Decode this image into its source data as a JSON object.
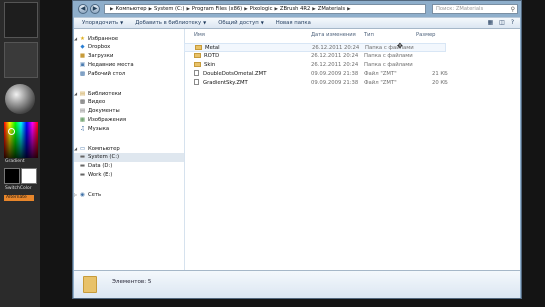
{
  "zbrush": {
    "gradient_label": "Gradient",
    "switch_color_label": "SwitchColor",
    "alternate_label": "Alternate"
  },
  "address": {
    "breadcrumbs": [
      "Компьютер",
      "System (C:)",
      "Program Files (x86)",
      "Pixologic",
      "ZBrush 4R2",
      "ZMaterials"
    ],
    "search_placeholder": "Поиск: ZMaterials"
  },
  "toolbar": {
    "organize": "Упорядочить",
    "add_to_library": "Добавить в библиотеку",
    "share": "Общий доступ",
    "new_folder": "Новая папка"
  },
  "nav": {
    "favorites": "Избранное",
    "dropbox": "Dropbox",
    "downloads": "Загрузки",
    "recent": "Недавние места",
    "desktop": "Рабочий стол",
    "libraries": "Библиотеки",
    "videos": "Видео",
    "documents": "Документы",
    "images": "Изображения",
    "music": "Музыка",
    "computer": "Компьютер",
    "drive_c": "System (C:)",
    "drive_d": "Data (D:)",
    "drive_e": "Work (E:)",
    "network": "Сеть"
  },
  "columns": {
    "name": "Имя",
    "modified": "Дата изменения",
    "type": "Тип",
    "size": "Размер"
  },
  "files": [
    {
      "name": "Metal",
      "modified": "26.12.2011 20:24",
      "type": "Папка с файлами",
      "size": ""
    },
    {
      "name": "ROTD",
      "modified": "26.12.2011 20:24",
      "type": "Папка с файлами",
      "size": ""
    },
    {
      "name": "Skin",
      "modified": "26.12.2011 20:24",
      "type": "Папка с файлами",
      "size": ""
    },
    {
      "name": "DoubleDotsOmetal.ZMT",
      "modified": "09.09.2009 21:38",
      "type": "Файл \"ZMT\"",
      "size": "21 КБ"
    },
    {
      "name": "GradientSky.ZMT",
      "modified": "09.09.2009 21:38",
      "type": "Файл \"ZMT\"",
      "size": "20 КБ"
    }
  ],
  "details": {
    "count_label": "Элементов: 5"
  },
  "colors": {
    "window_frame": "#8eaecb",
    "folder": "#e8c26a",
    "zbrush_alternate": "#e8862b"
  }
}
